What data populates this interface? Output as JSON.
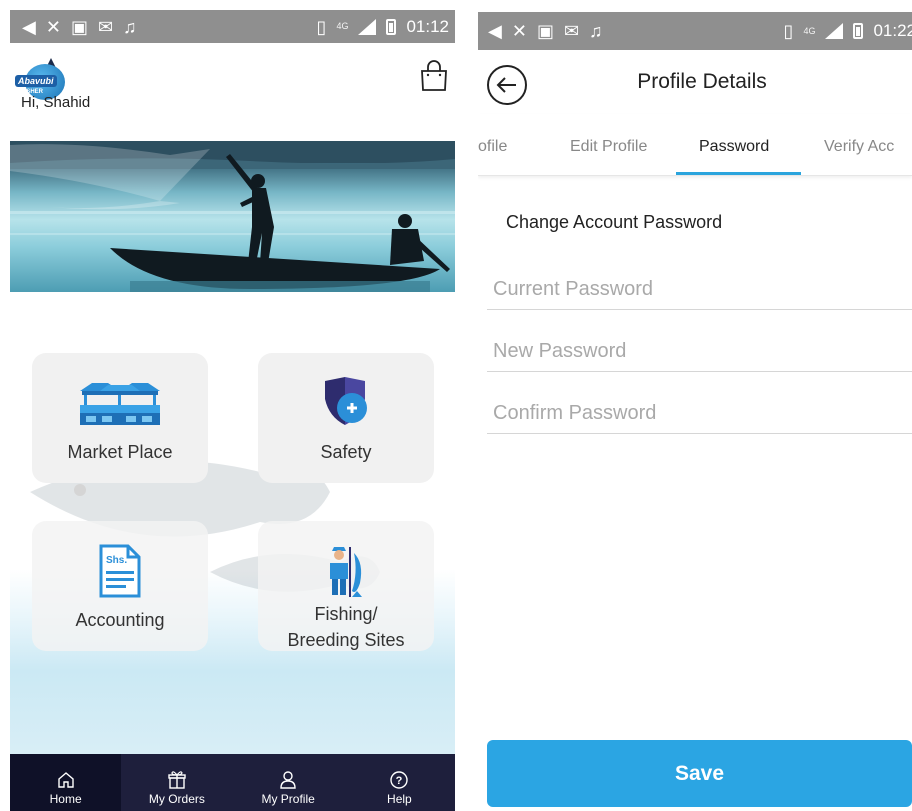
{
  "home": {
    "status_bar": {
      "time": "01:12",
      "network": "4G"
    },
    "greeting": "Hi, Shahid",
    "logo": {
      "text": "Abavubi",
      "subtext": "FISHER"
    },
    "tiles": [
      {
        "label": "Market Place"
      },
      {
        "label": "Safety"
      },
      {
        "label": "Accounting",
        "icon_text": "Shs."
      },
      {
        "label_line1": "Fishing/",
        "label_line2": "Breeding Sites"
      }
    ],
    "nav": [
      {
        "label": "Home",
        "icon": "home-icon",
        "active": true
      },
      {
        "label": "My Orders",
        "icon": "gift-icon"
      },
      {
        "label": "My Profile",
        "icon": "person-icon"
      },
      {
        "label": "Help",
        "icon": "help-icon"
      }
    ]
  },
  "profile": {
    "status_bar": {
      "time": "01:22",
      "network": "4G"
    },
    "title": "Profile Details",
    "tabs": [
      {
        "label": "ofile"
      },
      {
        "label": "Edit Profile"
      },
      {
        "label": "Password",
        "active": true
      },
      {
        "label": "Verify Acc"
      }
    ],
    "section_title": "Change Account Password",
    "fields": {
      "current_placeholder": "Current Password",
      "new_placeholder": "New Password",
      "confirm_placeholder": "Confirm Password"
    },
    "save_label": "Save"
  },
  "colors": {
    "accent": "#2ba5e3",
    "nav_bg": "#1e1f3c",
    "status_bar": "#8f8f8f",
    "tile_bg": "#f1f1f1",
    "icon_blue": "#2b8fd8"
  }
}
